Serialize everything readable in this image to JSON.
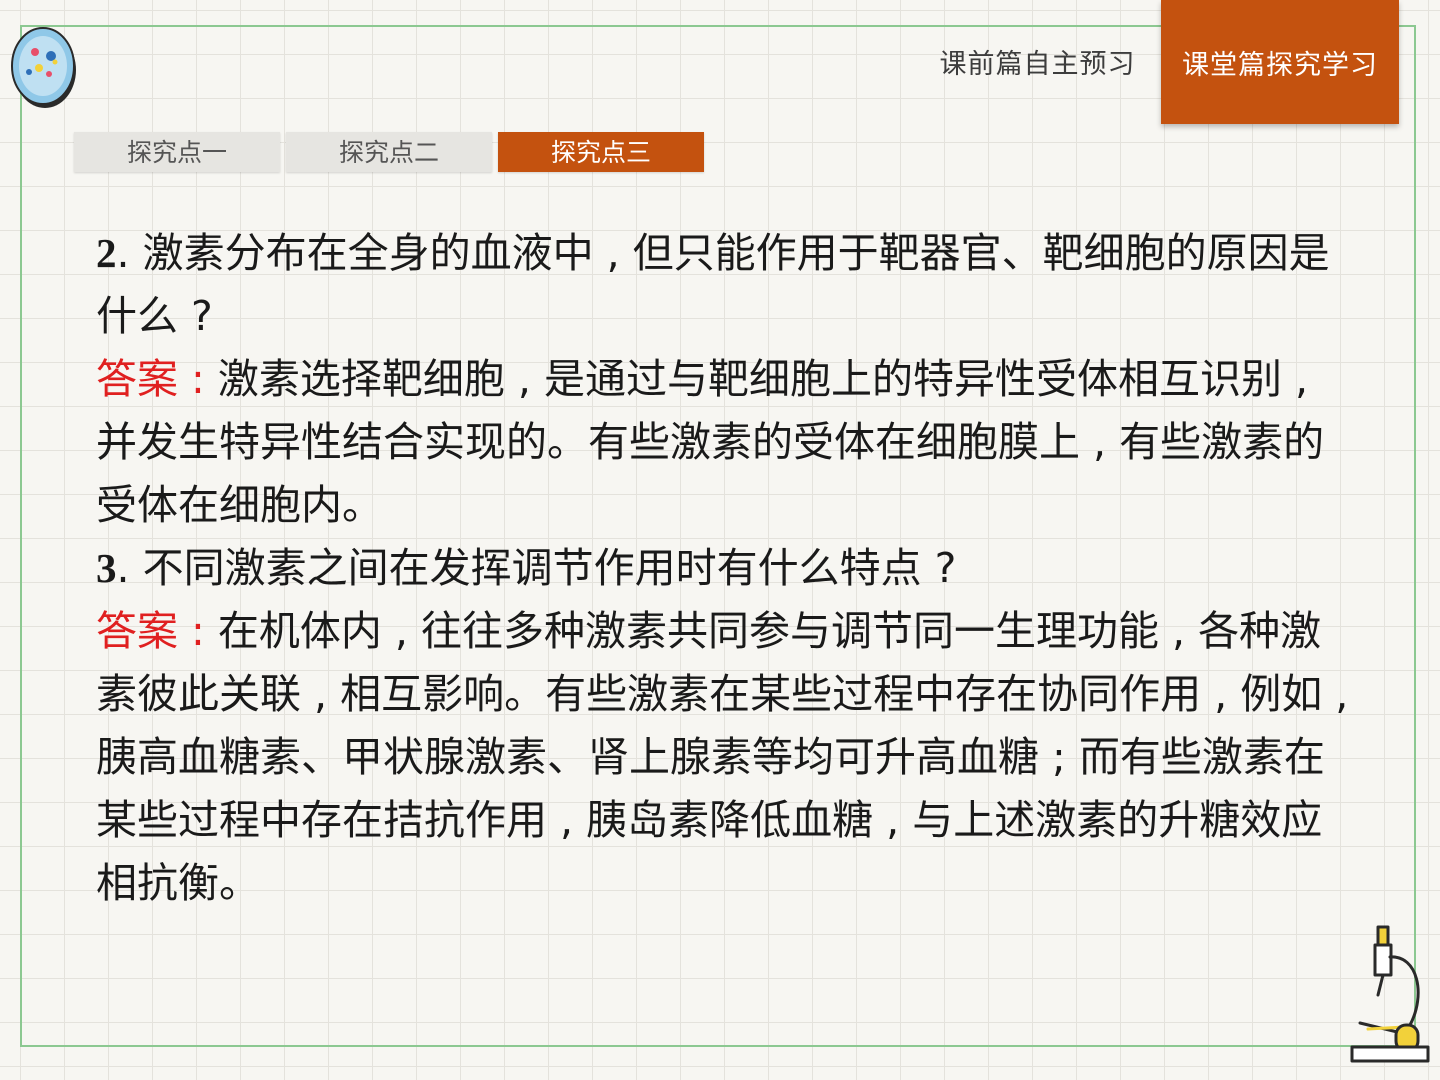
{
  "header": {
    "tabs": [
      {
        "label": "课前篇自主预习",
        "active": false
      },
      {
        "label": "课堂篇探究学习",
        "active": true
      }
    ]
  },
  "subtabs": [
    {
      "label": "探究点一",
      "active": false
    },
    {
      "label": "探究点二",
      "active": false
    },
    {
      "label": "探究点三",
      "active": true
    }
  ],
  "content": {
    "q2": {
      "number": "2",
      "text": ". 激素分布在全身的血液中 , 但只能作用于靶器官、靶细胞的原因是什么 ?"
    },
    "a2": {
      "label": "答案 :",
      "text": " 激素选择靶细胞 , 是通过与靶细胞上的特异性受体相互识别 , 并发生特异性结合实现的。有些激素的受体在细胞膜上 , 有些激素的受体在细胞内。"
    },
    "q3": {
      "number": "3",
      "text": ". 不同激素之间在发挥调节作用时有什么特点 ?"
    },
    "a3": {
      "label": "答案 :",
      "text": " 在机体内 , 往往多种激素共同参与调节同一生理功能 , 各种激素彼此关联 , 相互影响。有些激素在某些过程中存在协同作用 , 例如 , 胰高血糖素、甲状腺激素、肾上腺素等均可升高血糖 ; 而有些激素在某些过程中存在拮抗作用 , 胰岛素降低血糖 , 与上述激素的升糖效应相抗衡。"
    }
  },
  "colors": {
    "accent": "#c4520f",
    "answer_label": "#e02020",
    "frame": "#8cc891"
  }
}
